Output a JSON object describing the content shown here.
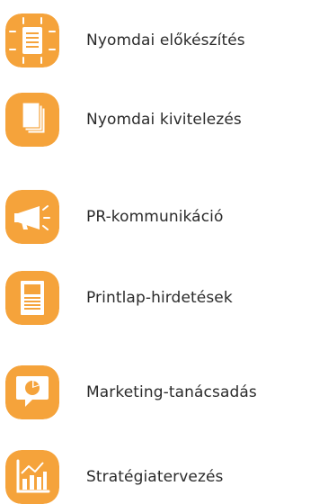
{
  "accent_color": "#F5A33B",
  "accent_light": "#F8BF6F",
  "services": [
    {
      "label": "Nyomdai előkészítés",
      "icon": "prepress-document-icon"
    },
    {
      "label": "Nyomdai kivitelezés",
      "icon": "print-stack-icon"
    },
    {
      "label": "PR-kommunikáció",
      "icon": "megaphone-icon"
    },
    {
      "label": "Printlap-hirdetések",
      "icon": "print-ad-icon"
    },
    {
      "label": "Marketing-tanácsadás",
      "icon": "marketing-chat-icon"
    },
    {
      "label": "Stratégiatervezés",
      "icon": "strategy-chart-icon"
    }
  ]
}
